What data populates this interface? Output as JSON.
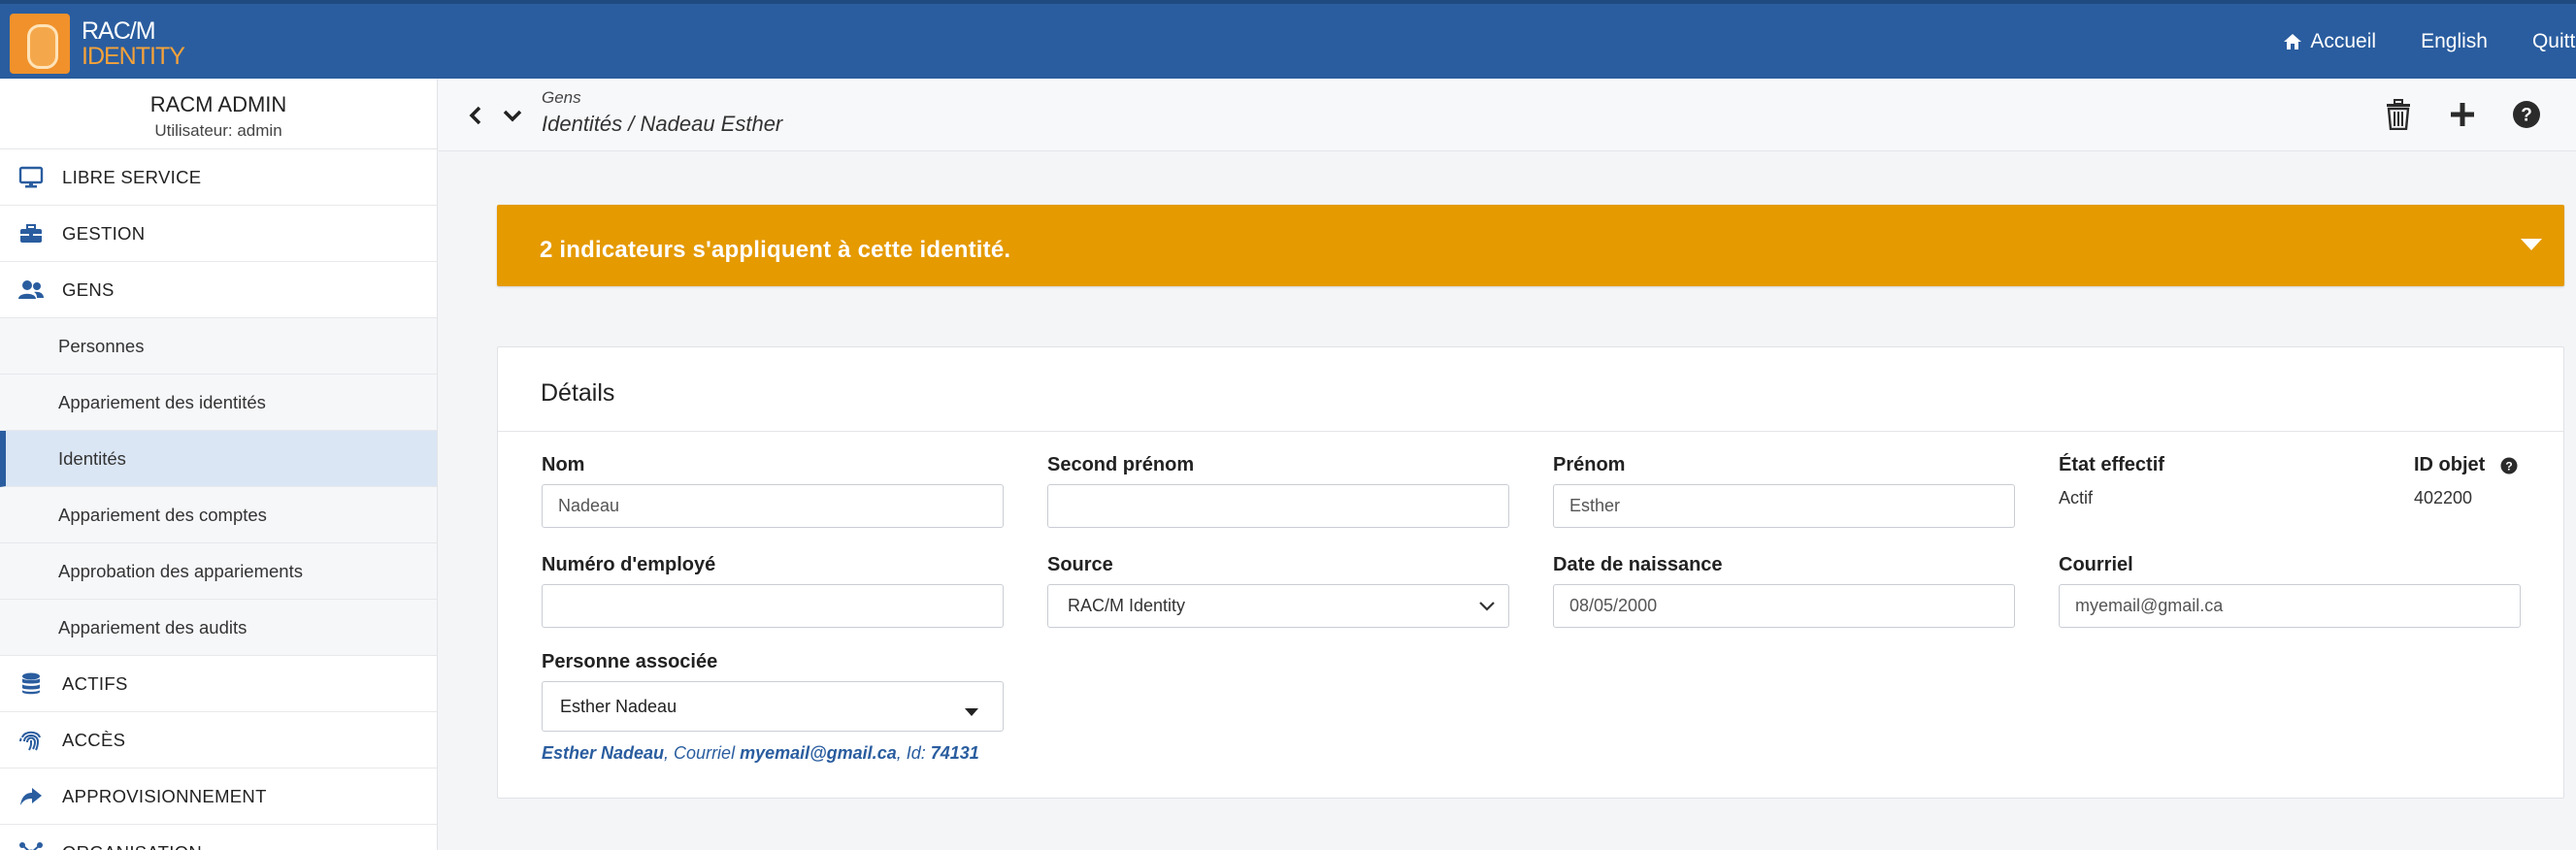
{
  "brand": {
    "line1": "RAC/M",
    "line2": "IDENTITY"
  },
  "topnav": {
    "home": "Accueil",
    "language": "English",
    "quit": "Quitter"
  },
  "sidebar": {
    "user_name": "RACM ADMIN",
    "user_role": "Utilisateur: admin",
    "items": {
      "libre_service": "LIBRE SERVICE",
      "gestion": "GESTION",
      "gens": "GENS",
      "actifs": "ACTIFS",
      "acces": "ACCÈS",
      "approvisionnement": "APPROVISIONNEMENT",
      "organisation": "ORGANISATION"
    },
    "subitems": {
      "personnes": "Personnes",
      "appariement_identites": "Appariement des identités",
      "identites": "Identités",
      "appariement_comptes": "Appariement des comptes",
      "approbation": "Approbation des appariements",
      "appariement_audits": "Appariement des audits"
    }
  },
  "header": {
    "section": "Gens",
    "breadcrumb": "Identités / Nadeau Esther"
  },
  "banner": {
    "text": "2 indicateurs s'appliquent à cette identité."
  },
  "details": {
    "title": "Détails",
    "nom": {
      "label": "Nom",
      "value": "Nadeau"
    },
    "second_prenom": {
      "label": "Second prénom",
      "value": ""
    },
    "prenom": {
      "label": "Prénom",
      "value": "Esther"
    },
    "etat": {
      "label": "État effectif",
      "value": "Actif"
    },
    "id_objet": {
      "label": "ID objet",
      "value": "402200"
    },
    "numero_employe": {
      "label": "Numéro d'employé",
      "value": ""
    },
    "source": {
      "label": "Source",
      "value": "RAC/M Identity"
    },
    "date_naissance": {
      "label": "Date de naissance",
      "value": "08/05/2000"
    },
    "courriel": {
      "label": "Courriel",
      "value": "myemail@gmail.ca"
    },
    "personne_associee": {
      "label": "Personne associée",
      "value": "Esther Nadeau",
      "info_name": "Esther Nadeau",
      "info_sep1": ", Courriel ",
      "info_email": "myemail@gmail.ca",
      "info_sep2": ", Id: ",
      "info_id": "74131"
    }
  },
  "colors": {
    "topbar": "#2a5d9f",
    "banner": "#e59a00",
    "accent": "#2a5d9f",
    "logo": "#f0912b"
  }
}
